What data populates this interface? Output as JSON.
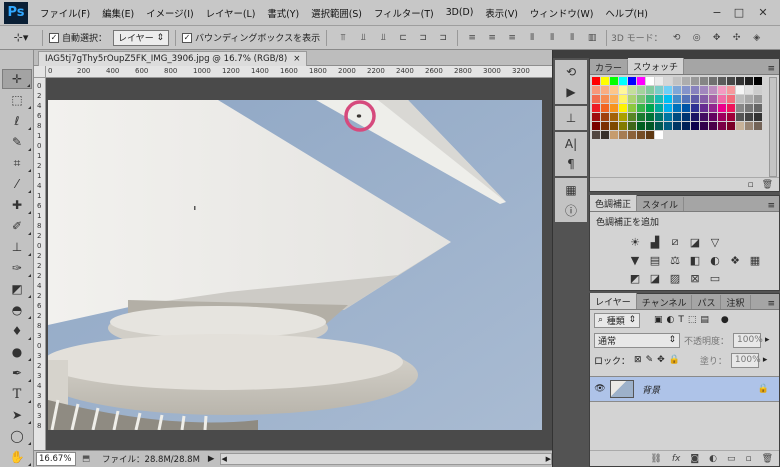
{
  "app": {
    "logo": "Ps"
  },
  "menubar": {
    "items": [
      "ファイル(F)",
      "編集(E)",
      "イメージ(I)",
      "レイヤー(L)",
      "書式(Y)",
      "選択範囲(S)",
      "フィルター(T)",
      "3D(D)",
      "表示(V)",
      "ウィンドウ(W)",
      "ヘルプ(H)"
    ]
  },
  "options": {
    "auto_select_label": "自動選択：",
    "auto_select_checked": true,
    "target_value": "レイヤー",
    "bbox_label": "バウンディングボックスを表示",
    "bbox_checked": true,
    "mode3d_label": "3D モード："
  },
  "document": {
    "tab_title": "IAG5tj7gThy5rOupZ5FK_IMG_3906.jpg @ 16.7% (RGB/8)",
    "tab_close": "×",
    "hruler_labels": [
      "0",
      "200",
      "400",
      "600",
      "800",
      "1000",
      "1200",
      "1400",
      "1600",
      "1800",
      "2000",
      "2200",
      "2400",
      "2600",
      "2800",
      "3000",
      "3200"
    ],
    "vruler_labels": [
      "0",
      "2",
      "4",
      "6",
      "8",
      "1",
      "0",
      "1",
      "2",
      "1",
      "4",
      "1",
      "6",
      "1",
      "8",
      "2",
      "0",
      "2",
      "2",
      "2",
      "4",
      "2",
      "6",
      "2",
      "8",
      "3",
      "0",
      "3",
      "2",
      "3",
      "4",
      "3",
      "6",
      "3",
      "8"
    ]
  },
  "status": {
    "zoom": "16.67%",
    "file_info": "ファイル：28.8M/28.8M"
  },
  "swatches": {
    "tabs": [
      "カラー",
      "スウォッチ"
    ],
    "colors": [
      "#ff0000",
      "#ffff00",
      "#00ff00",
      "#00ffff",
      "#0000ff",
      "#ff00ff",
      "#ffffff",
      "#ebebeb",
      "#d6d6d6",
      "#c2c2c2",
      "#adadad",
      "#999999",
      "#858585",
      "#707070",
      "#5c5c5c",
      "#474747",
      "#333333",
      "#1f1f1f",
      "#000000",
      "#f7977a",
      "#f9ad81",
      "#fdc68a",
      "#fff79a",
      "#c4df9b",
      "#a3d39c",
      "#82ca9d",
      "#7bcdc8",
      "#6ecff6",
      "#7ea7d8",
      "#8493ca",
      "#8882be",
      "#a187be",
      "#bc8dbf",
      "#f49ac2",
      "#f6989d",
      "#f5f5f5",
      "#e0e0e0",
      "#cccccc",
      "#f26c4f",
      "#f68e55",
      "#fbaf5c",
      "#fff467",
      "#acd372",
      "#7cc576",
      "#3bb878",
      "#1abbb4",
      "#00bff3",
      "#438cca",
      "#5574b9",
      "#605ca8",
      "#855fa8",
      "#a763a8",
      "#f06ea9",
      "#f26d7d",
      "#bbbbbb",
      "#aaaaaa",
      "#999999",
      "#ed1c24",
      "#f26522",
      "#f7941d",
      "#fff200",
      "#8dc73f",
      "#39b54a",
      "#00a651",
      "#00a99d",
      "#00aeef",
      "#0072bc",
      "#0054a6",
      "#2e3192",
      "#662d91",
      "#92278f",
      "#ec008c",
      "#ed145b",
      "#888888",
      "#777777",
      "#666666",
      "#9e0b0f",
      "#a0410d",
      "#a36209",
      "#aba000",
      "#598527",
      "#1a7b30",
      "#007236",
      "#00746b",
      "#0076a3",
      "#004b80",
      "#003471",
      "#1b1464",
      "#440e62",
      "#630460",
      "#9e005d",
      "#9e0039",
      "#555555",
      "#444444",
      "#333333",
      "#790000",
      "#7b2e00",
      "#7d4900",
      "#827b00",
      "#406618",
      "#005e20",
      "#005826",
      "#005952",
      "#005b7f",
      "#003663",
      "#002157",
      "#0d004c",
      "#32004b",
      "#4b0049",
      "#7b0046",
      "#7a0026",
      "#c7b299",
      "#998675",
      "#736357",
      "#534741",
      "#37302a",
      "#c69c6d",
      "#a67c52",
      "#8c6239",
      "#754c24",
      "#603913",
      "#ffffff"
    ]
  },
  "adjustments": {
    "tabs": [
      "色調補正",
      "スタイル"
    ],
    "title": "色調補正を追加"
  },
  "layers": {
    "tabs": [
      "レイヤー",
      "チャンネル",
      "パス",
      "注釈"
    ],
    "filter_value": "種類",
    "blend_mode": "通常",
    "opacity_label": "不透明度：",
    "opacity_value": "100%",
    "lock_label": "ロック：",
    "fill_label": "塗り：",
    "fill_value": "100%",
    "layer_name": "背景",
    "layer_selected_color": "#aec3e8"
  }
}
